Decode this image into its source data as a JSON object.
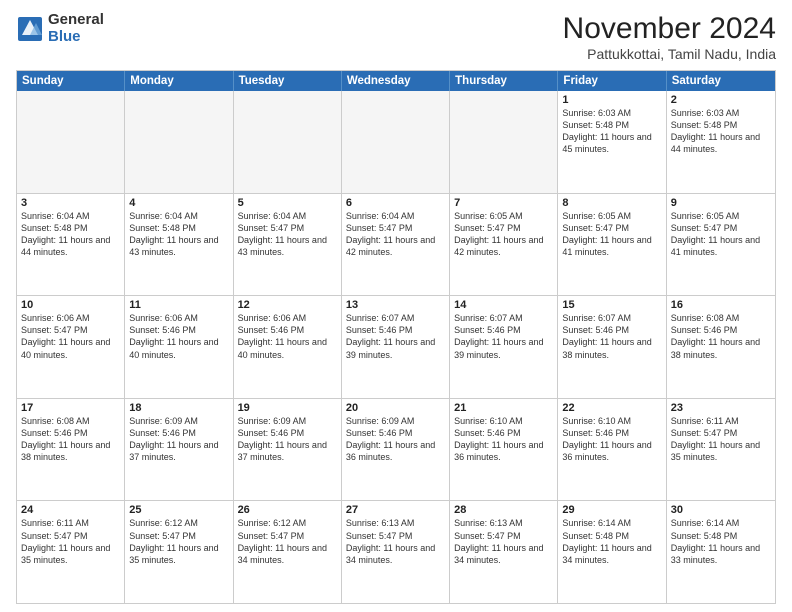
{
  "header": {
    "logo_general": "General",
    "logo_blue": "Blue",
    "month_title": "November 2024",
    "location": "Pattukkottai, Tamil Nadu, India"
  },
  "calendar": {
    "days_of_week": [
      "Sunday",
      "Monday",
      "Tuesday",
      "Wednesday",
      "Thursday",
      "Friday",
      "Saturday"
    ],
    "weeks": [
      [
        {
          "day": "",
          "empty": true
        },
        {
          "day": "",
          "empty": true
        },
        {
          "day": "",
          "empty": true
        },
        {
          "day": "",
          "empty": true
        },
        {
          "day": "",
          "empty": true
        },
        {
          "day": "1",
          "sunrise": "6:03 AM",
          "sunset": "5:48 PM",
          "daylight": "11 hours and 45 minutes."
        },
        {
          "day": "2",
          "sunrise": "6:03 AM",
          "sunset": "5:48 PM",
          "daylight": "11 hours and 44 minutes."
        }
      ],
      [
        {
          "day": "3",
          "sunrise": "6:04 AM",
          "sunset": "5:48 PM",
          "daylight": "11 hours and 44 minutes."
        },
        {
          "day": "4",
          "sunrise": "6:04 AM",
          "sunset": "5:48 PM",
          "daylight": "11 hours and 43 minutes."
        },
        {
          "day": "5",
          "sunrise": "6:04 AM",
          "sunset": "5:47 PM",
          "daylight": "11 hours and 43 minutes."
        },
        {
          "day": "6",
          "sunrise": "6:04 AM",
          "sunset": "5:47 PM",
          "daylight": "11 hours and 42 minutes."
        },
        {
          "day": "7",
          "sunrise": "6:05 AM",
          "sunset": "5:47 PM",
          "daylight": "11 hours and 42 minutes."
        },
        {
          "day": "8",
          "sunrise": "6:05 AM",
          "sunset": "5:47 PM",
          "daylight": "11 hours and 41 minutes."
        },
        {
          "day": "9",
          "sunrise": "6:05 AM",
          "sunset": "5:47 PM",
          "daylight": "11 hours and 41 minutes."
        }
      ],
      [
        {
          "day": "10",
          "sunrise": "6:06 AM",
          "sunset": "5:47 PM",
          "daylight": "11 hours and 40 minutes."
        },
        {
          "day": "11",
          "sunrise": "6:06 AM",
          "sunset": "5:46 PM",
          "daylight": "11 hours and 40 minutes."
        },
        {
          "day": "12",
          "sunrise": "6:06 AM",
          "sunset": "5:46 PM",
          "daylight": "11 hours and 40 minutes."
        },
        {
          "day": "13",
          "sunrise": "6:07 AM",
          "sunset": "5:46 PM",
          "daylight": "11 hours and 39 minutes."
        },
        {
          "day": "14",
          "sunrise": "6:07 AM",
          "sunset": "5:46 PM",
          "daylight": "11 hours and 39 minutes."
        },
        {
          "day": "15",
          "sunrise": "6:07 AM",
          "sunset": "5:46 PM",
          "daylight": "11 hours and 38 minutes."
        },
        {
          "day": "16",
          "sunrise": "6:08 AM",
          "sunset": "5:46 PM",
          "daylight": "11 hours and 38 minutes."
        }
      ],
      [
        {
          "day": "17",
          "sunrise": "6:08 AM",
          "sunset": "5:46 PM",
          "daylight": "11 hours and 38 minutes."
        },
        {
          "day": "18",
          "sunrise": "6:09 AM",
          "sunset": "5:46 PM",
          "daylight": "11 hours and 37 minutes."
        },
        {
          "day": "19",
          "sunrise": "6:09 AM",
          "sunset": "5:46 PM",
          "daylight": "11 hours and 37 minutes."
        },
        {
          "day": "20",
          "sunrise": "6:09 AM",
          "sunset": "5:46 PM",
          "daylight": "11 hours and 36 minutes."
        },
        {
          "day": "21",
          "sunrise": "6:10 AM",
          "sunset": "5:46 PM",
          "daylight": "11 hours and 36 minutes."
        },
        {
          "day": "22",
          "sunrise": "6:10 AM",
          "sunset": "5:46 PM",
          "daylight": "11 hours and 36 minutes."
        },
        {
          "day": "23",
          "sunrise": "6:11 AM",
          "sunset": "5:47 PM",
          "daylight": "11 hours and 35 minutes."
        }
      ],
      [
        {
          "day": "24",
          "sunrise": "6:11 AM",
          "sunset": "5:47 PM",
          "daylight": "11 hours and 35 minutes."
        },
        {
          "day": "25",
          "sunrise": "6:12 AM",
          "sunset": "5:47 PM",
          "daylight": "11 hours and 35 minutes."
        },
        {
          "day": "26",
          "sunrise": "6:12 AM",
          "sunset": "5:47 PM",
          "daylight": "11 hours and 34 minutes."
        },
        {
          "day": "27",
          "sunrise": "6:13 AM",
          "sunset": "5:47 PM",
          "daylight": "11 hours and 34 minutes."
        },
        {
          "day": "28",
          "sunrise": "6:13 AM",
          "sunset": "5:47 PM",
          "daylight": "11 hours and 34 minutes."
        },
        {
          "day": "29",
          "sunrise": "6:14 AM",
          "sunset": "5:48 PM",
          "daylight": "11 hours and 34 minutes."
        },
        {
          "day": "30",
          "sunrise": "6:14 AM",
          "sunset": "5:48 PM",
          "daylight": "11 hours and 33 minutes."
        }
      ]
    ]
  }
}
